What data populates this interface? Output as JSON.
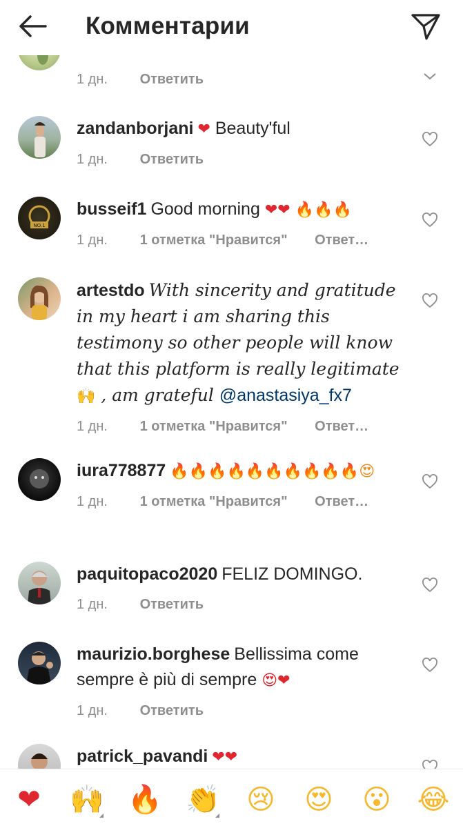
{
  "header": {
    "title": "Комментарии"
  },
  "comments": [
    {
      "time": "1 дн.",
      "reply": "Ответить"
    },
    {
      "username": "zandanborjani",
      "text_emoji": "❤",
      "text": " Beauty'ful",
      "time": "1 дн.",
      "reply": "Ответить"
    },
    {
      "username": "busseif1",
      "text": "Good morning ",
      "emoji": "❤❤ 🔥🔥🔥",
      "time": "1 дн.",
      "likes": "1 отметка \"Нравится\"",
      "reply": "Ответ…"
    },
    {
      "username": "artestdo",
      "text": "With sincerity and gratitude in my heart i am sharing this testimony so other people will know that this platform is really legitimate ",
      "emoji": "🙌",
      "text2": " , am grateful ",
      "mention": "@anastasiya_fx7",
      "time": "1 дн.",
      "likes": "1 отметка \"Нравится\"",
      "reply": "Ответ…"
    },
    {
      "username": "iura778877",
      "emoji": "🔥🔥🔥🔥🔥🔥🔥🔥🔥🔥😍",
      "time": "1 дн.",
      "likes": "1 отметка \"Нравится\"",
      "reply": "Ответ…"
    },
    {
      "username": "paquitopaco2020",
      "text": "FELIZ  DOMINGO.",
      "time": "1 дн.",
      "reply": "Ответить"
    },
    {
      "username": "maurizio.borghese",
      "text": "Bellissima come sempre è più di sempre ",
      "emoji": "😍❤",
      "time": "1 дн.",
      "reply": "Ответить"
    },
    {
      "username": "patrick_pavandi",
      "emoji": "❤❤"
    }
  ],
  "emoji_bar": [
    "❤",
    "🙌",
    "🔥",
    "👏",
    "😢",
    "😍",
    "😮",
    "😂"
  ],
  "colors": {
    "heart": "#e0262e",
    "fire": "#f5a623",
    "mention": "#00376b",
    "meta": "#8e8e8e"
  }
}
